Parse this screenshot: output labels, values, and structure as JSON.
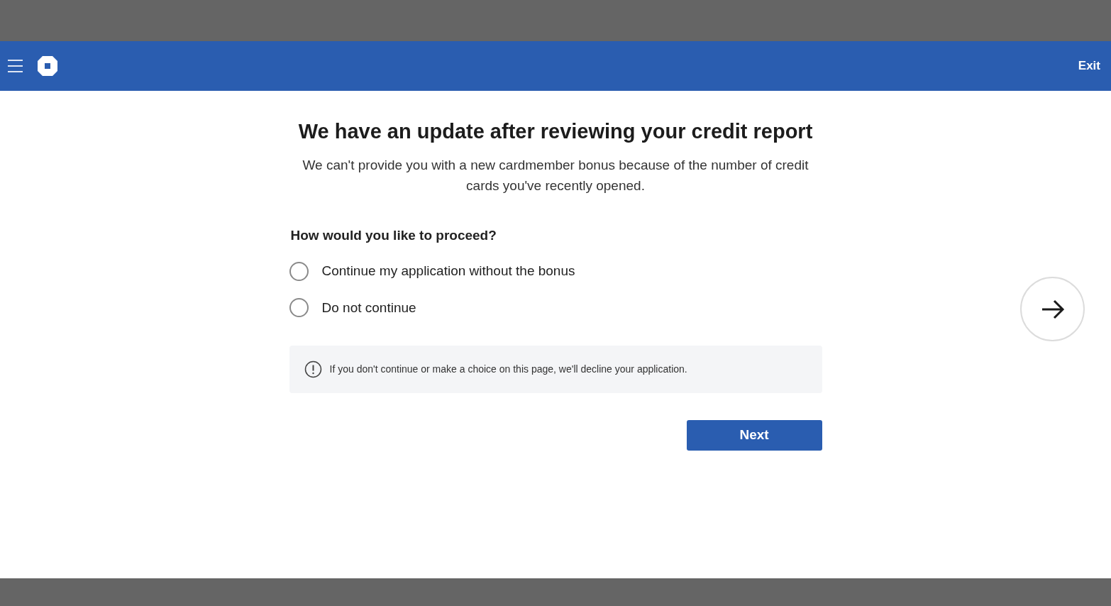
{
  "header": {
    "exit": "Exit"
  },
  "title": "We have an update after reviewing your credit report",
  "subtitle": "We can't provide you with a new cardmember bonus because of the number of credit cards you've recently opened.",
  "question": "How would you like to proceed?",
  "options": [
    {
      "label": "Continue my application without the bonus",
      "selected": false
    },
    {
      "label": "Do not continue",
      "selected": false
    }
  ],
  "notice": "If you don't continue or make a choice on this page, we'll decline your application.",
  "next_button": "Next"
}
